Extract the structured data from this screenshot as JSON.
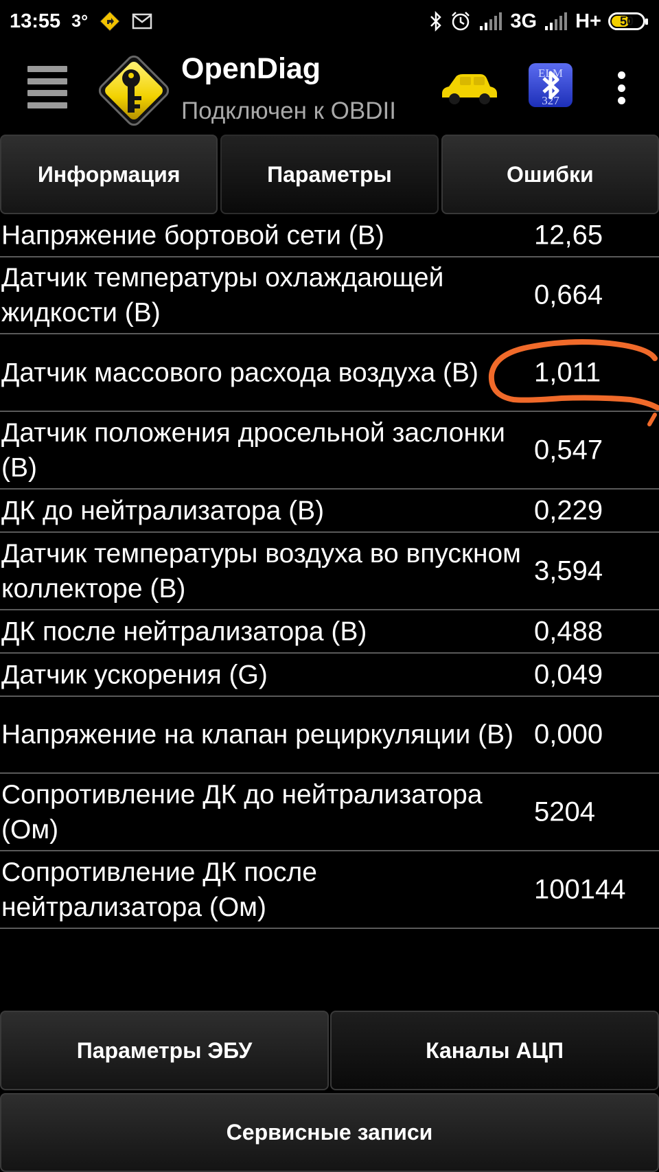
{
  "status_bar": {
    "time": "13:55",
    "temperature": "3°",
    "network_3g": "3G",
    "network_hplus": "H+",
    "battery_level": "50",
    "icons": [
      "navigation-icon",
      "mail-icon",
      "bluetooth-icon",
      "alarm-icon",
      "signal-icon",
      "battery-icon"
    ]
  },
  "app_bar": {
    "title": "OpenDiag",
    "subtitle": "Подключен к OBDII",
    "logo_icon": "key-sign-icon",
    "car_icon": "car-icon",
    "bluetooth_icon": "bluetooth-elm327-icon",
    "bluetooth_badge": "ELM 327",
    "accent_color": "#f2d200"
  },
  "tabs": [
    {
      "label": "Информация",
      "active": false
    },
    {
      "label": "Параметры",
      "active": true
    },
    {
      "label": "Ошибки",
      "active": false
    }
  ],
  "parameters": [
    {
      "name": "Напряжение бортовой сети (В)",
      "value": "12,65"
    },
    {
      "name": "Датчик температуры охлаждающей жидкости (В)",
      "value": "0,664"
    },
    {
      "name": "Датчик массового расхода воздуха (В)",
      "value": "1,011",
      "highlighted": true
    },
    {
      "name": "Датчик положения дросельной заслонки (В)",
      "value": "0,547"
    },
    {
      "name": "ДК до нейтрализатора (В)",
      "value": "0,229"
    },
    {
      "name": "Датчик температуры воздуха во впускном коллекторе (В)",
      "value": "3,594"
    },
    {
      "name": "ДК после нейтрализатора (В)",
      "value": "0,488"
    },
    {
      "name": "Датчик ускорения (G)",
      "value": "0,049"
    },
    {
      "name": "Напряжение на клапан рециркуляции (В)",
      "value": "0,000"
    },
    {
      "name": "Сопротивление ДК до нейтрализатора (Ом)",
      "value": "5204"
    },
    {
      "name": "Сопротивление ДК после нейтрализатора (Ом)",
      "value": "100144"
    }
  ],
  "highlight_color": "#f06a2a",
  "bottom_buttons": {
    "ecu_params": "Параметры ЭБУ",
    "adc_channels": "Каналы АЦП",
    "service_records": "Сервисные записи"
  }
}
